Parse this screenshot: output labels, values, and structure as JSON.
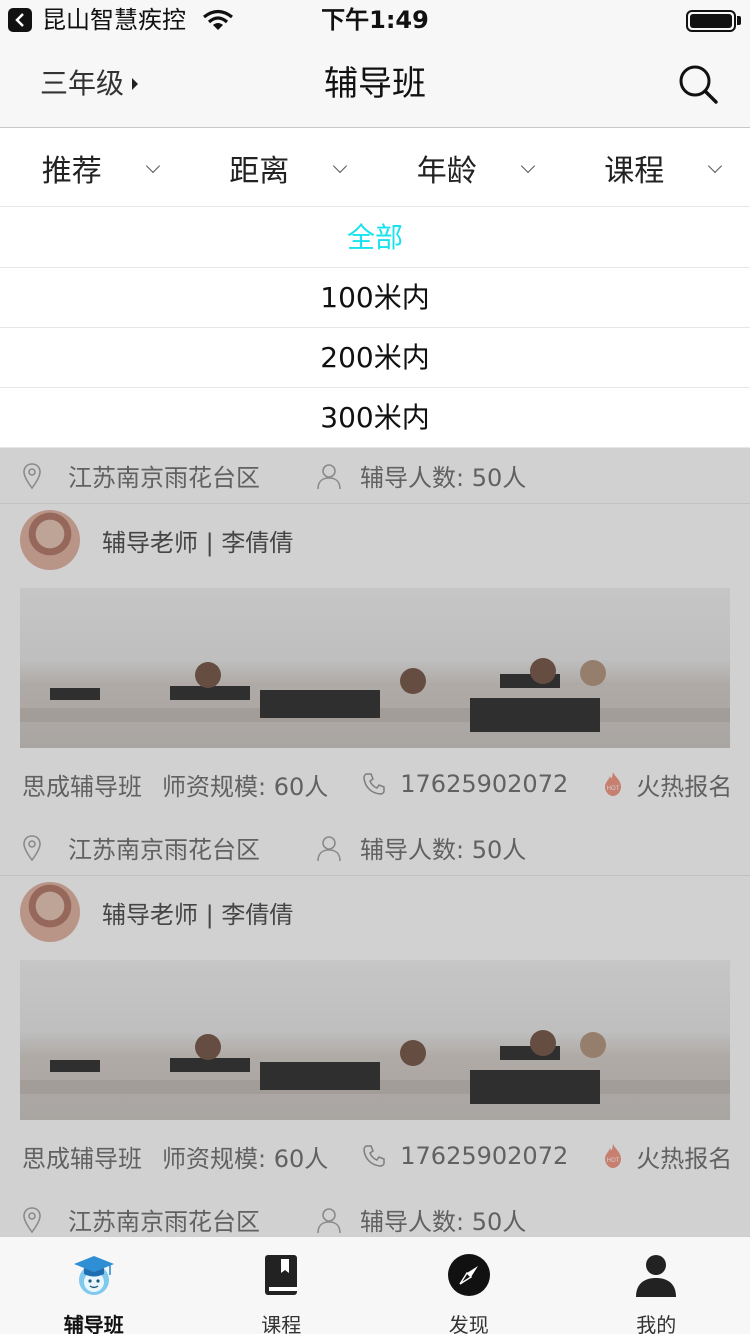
{
  "status_bar": {
    "carrier": "昆山智慧疾控",
    "time": "下午1:49"
  },
  "nav": {
    "grade": "三年级",
    "title": "辅导班"
  },
  "filters": [
    {
      "label": "推荐"
    },
    {
      "label": "距离"
    },
    {
      "label": "年龄"
    },
    {
      "label": "课程"
    }
  ],
  "dropdown": {
    "options": [
      "全部",
      "100米内",
      "200米内",
      "300米内"
    ],
    "active_index": 0,
    "active_color": "#19e3ee"
  },
  "list": {
    "location_rows": [
      {
        "address": "江苏南京雨花台区",
        "tutors": "辅导人数: 50人"
      },
      {
        "address": "江苏南京雨花台区",
        "tutors": "辅导人数: 50人"
      },
      {
        "address": "江苏南京雨花台区",
        "tutors": "辅导人数: 50人"
      }
    ],
    "cards": [
      {
        "teacher": "辅导老师 | 李倩倩",
        "org": "思成辅导班",
        "scale": "师资规模:  60人",
        "phone": "17625902072",
        "hot": "火热报名"
      },
      {
        "teacher": "辅导老师 | 李倩倩",
        "org": "思成辅导班",
        "scale": "师资规模:  60人",
        "phone": "17625902072",
        "hot": "火热报名"
      }
    ]
  },
  "tabbar": {
    "items": [
      {
        "label": "辅导班",
        "icon": "graduate-icon"
      },
      {
        "label": "课程",
        "icon": "book-icon"
      },
      {
        "label": "发现",
        "icon": "compass-icon"
      },
      {
        "label": "我的",
        "icon": "user-icon"
      }
    ],
    "active_index": 0
  }
}
